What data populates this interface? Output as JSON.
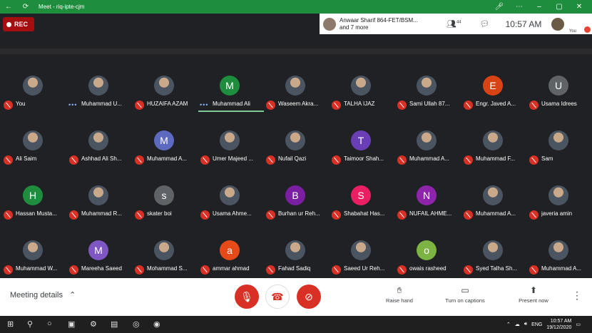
{
  "titlebar": {
    "title": "Meet - riq-ipte-cjm"
  },
  "topbar": {
    "rec_label": "REC",
    "speaker_line1": "Anwaar Sharif 864-FET/BSM...",
    "speaker_line2": "and 7 more",
    "people_count": "44",
    "time": "10:57 AM",
    "you_label": "You"
  },
  "participants": [
    {
      "name": "You",
      "avatar": "photo",
      "muted": true
    },
    {
      "name": "Muhammad U...",
      "avatar": "photo",
      "muted": false,
      "talking": true
    },
    {
      "name": "HUZAIFA AZAM",
      "avatar": "photo",
      "muted": true
    },
    {
      "name": "Muhammad Ali",
      "avatar": "M",
      "color": "#1e8e3e",
      "muted": false,
      "talking": true,
      "active": true
    },
    {
      "name": "Waseem Akra...",
      "avatar": "photo",
      "muted": true
    },
    {
      "name": "TALHA IJAZ",
      "avatar": "photo",
      "muted": true
    },
    {
      "name": "Sami Ullah 87...",
      "avatar": "photo",
      "muted": true
    },
    {
      "name": "Engr. Javed A...",
      "avatar": "E",
      "color": "#d84315",
      "muted": true
    },
    {
      "name": "Usama Idrees",
      "avatar": "U",
      "color": "#5f6368",
      "muted": true
    },
    {
      "name": "Ali Saim",
      "avatar": "photo",
      "muted": true
    },
    {
      "name": "Ashhad Ali Sh...",
      "avatar": "photo",
      "muted": true
    },
    {
      "name": "Muhammad A...",
      "avatar": "M",
      "color": "#5c6bc0",
      "muted": true
    },
    {
      "name": "Umer Majeed ...",
      "avatar": "photo",
      "muted": true
    },
    {
      "name": "Nufail Qazi",
      "avatar": "photo",
      "muted": true
    },
    {
      "name": "Taimoor Shah...",
      "avatar": "T",
      "color": "#6a3fb5",
      "muted": true
    },
    {
      "name": "Muhammad A...",
      "avatar": "photo",
      "muted": true
    },
    {
      "name": "Muhammad F...",
      "avatar": "photo",
      "muted": true
    },
    {
      "name": "Sam",
      "avatar": "photo",
      "muted": true
    },
    {
      "name": "Hassan Musta...",
      "avatar": "H",
      "color": "#1e8e3e",
      "muted": true
    },
    {
      "name": "Muhammad R...",
      "avatar": "photo",
      "muted": true
    },
    {
      "name": "skater boi",
      "avatar": "s",
      "color": "#5f6368",
      "muted": true
    },
    {
      "name": "Usama Ahme...",
      "avatar": "photo",
      "muted": true
    },
    {
      "name": "Burhan ur Reh...",
      "avatar": "B",
      "color": "#7b1fa2",
      "muted": true
    },
    {
      "name": "Shabahat Has...",
      "avatar": "S",
      "color": "#e91e63",
      "muted": true
    },
    {
      "name": "NUFAIL AHME...",
      "avatar": "N",
      "color": "#8e24aa",
      "muted": true
    },
    {
      "name": "Muhammad A...",
      "avatar": "photo",
      "muted": true
    },
    {
      "name": "javeria amin",
      "avatar": "photo",
      "muted": true
    },
    {
      "name": "Muhammad W...",
      "avatar": "photo",
      "muted": true
    },
    {
      "name": "Mareeha Saeed",
      "avatar": "M",
      "color": "#7e57c2",
      "muted": true
    },
    {
      "name": "Mohammad S...",
      "avatar": "photo",
      "muted": true
    },
    {
      "name": "ammar ahmad",
      "avatar": "a",
      "color": "#e64a19",
      "muted": true
    },
    {
      "name": "Fahad Sadiq",
      "avatar": "photo",
      "muted": true
    },
    {
      "name": "Saeed Ur Reh...",
      "avatar": "photo",
      "muted": true
    },
    {
      "name": "owais rasheed",
      "avatar": "o",
      "color": "#7cb342",
      "muted": true
    },
    {
      "name": "Syed Talha Sh...",
      "avatar": "photo",
      "muted": true
    },
    {
      "name": "Muhammad A...",
      "avatar": "photo",
      "muted": true
    }
  ],
  "bottombar": {
    "meeting_details": "Meeting details",
    "raise_hand": "Raise hand",
    "captions": "Turn on captions",
    "present": "Present now"
  },
  "taskbar": {
    "lang": "ENG",
    "time": "10:57 AM",
    "date": "19/12/2020"
  }
}
